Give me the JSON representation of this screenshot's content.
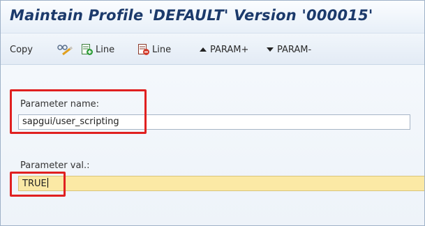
{
  "window": {
    "title": "Maintain Profile 'DEFAULT' Version '000015'"
  },
  "toolbar": {
    "copy_label": "Copy",
    "insert_line_label": "Line",
    "delete_line_label": "Line",
    "param_up_label": "PARAM+",
    "param_down_label": "PARAM-",
    "icons": [
      "glasses-wand-icon",
      "insert-line-icon",
      "delete-line-icon",
      "triangle-up-icon",
      "triangle-down-icon"
    ]
  },
  "form": {
    "param_name": {
      "label": "Parameter name:",
      "value": "sapgui/user_scripting"
    },
    "param_value": {
      "label": "Parameter val.:",
      "value": "TRUE"
    }
  },
  "colors": {
    "title": "#1c3a6b",
    "highlight_box": "#e02020",
    "active_field": "#fbe9a5",
    "insert_icon": "#2f9e3a",
    "delete_icon": "#d23a2a"
  }
}
